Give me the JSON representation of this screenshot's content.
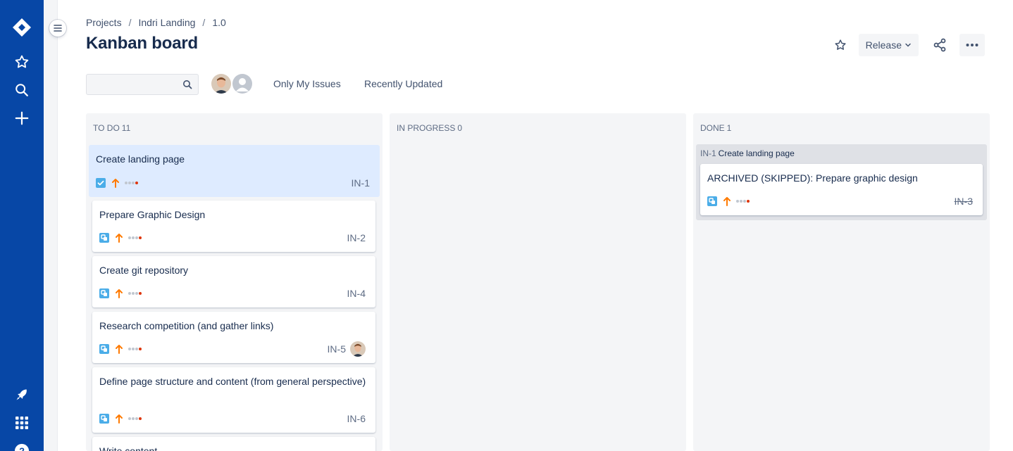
{
  "nav": {
    "icons": [
      "jira-logo-icon",
      "star-icon",
      "search-icon",
      "create-icon",
      "feedback-icon",
      "app-switcher-icon",
      "help-icon"
    ]
  },
  "breadcrumb": {
    "items": [
      "Projects",
      "Indri Landing",
      "1.0"
    ],
    "separator": "/"
  },
  "page": {
    "title": "Kanban board"
  },
  "header_actions": {
    "release_label": "Release"
  },
  "filters": {
    "search_placeholder": "",
    "quick_filters": [
      "Only My Issues",
      "Recently Updated"
    ]
  },
  "columns": [
    {
      "name": "TO DO",
      "count": "11",
      "cards": [
        {
          "summary": "Create landing page",
          "key": "IN-1",
          "type": "subtask",
          "priority": "high",
          "selected": true
        },
        {
          "summary": "Prepare Graphic Design",
          "key": "IN-2",
          "type": "subtask",
          "priority": "high"
        },
        {
          "summary": "Create git repository",
          "key": "IN-4",
          "type": "subtask",
          "priority": "high"
        },
        {
          "summary": "Research competition (and gather links)",
          "key": "IN-5",
          "type": "subtask",
          "priority": "high",
          "assignee": "avatar"
        },
        {
          "summary": "Define page structure and content (from general perspective)",
          "key": "IN-6",
          "type": "subtask",
          "priority": "high"
        },
        {
          "summary": "Write content",
          "key": "",
          "type": "subtask",
          "priority": "high"
        }
      ]
    },
    {
      "name": "IN PROGRESS",
      "count": "0",
      "cards": []
    },
    {
      "name": "DONE",
      "count": "1",
      "swimlane": {
        "parent_key": "IN-1",
        "parent_summary": "Create landing page"
      },
      "cards": [
        {
          "summary": "ARCHIVED (SKIPPED): Prepare graphic design",
          "key": "IN-3",
          "type": "subtask",
          "priority": "high",
          "struck": true
        }
      ]
    }
  ],
  "colors": {
    "nav_bg": "#0747a6",
    "column_bg": "#f4f5f7",
    "selected_card_bg": "#deebff",
    "priority_high": "#ff7a00",
    "subtask_blue": "#4bade8",
    "checkbox_blue": "#4bade8"
  }
}
